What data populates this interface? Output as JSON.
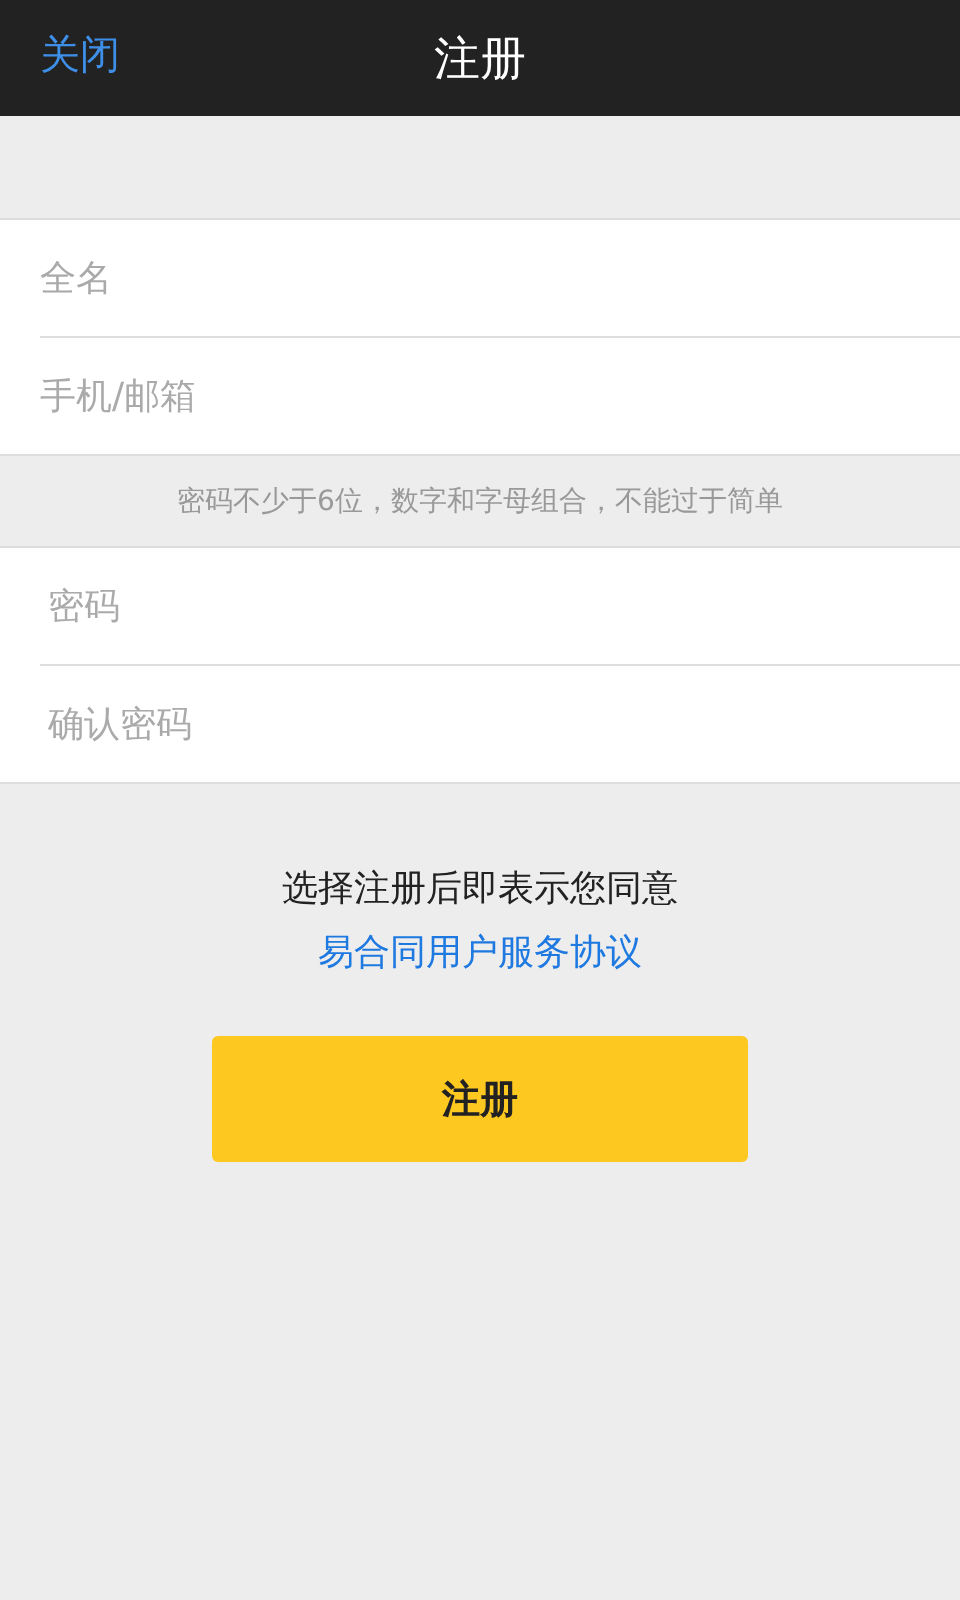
{
  "header": {
    "close": "关闭",
    "title": "注册"
  },
  "identity_fields": [
    {
      "placeholder": "全名"
    },
    {
      "placeholder": "手机/邮箱"
    }
  ],
  "password_hint": "密码不少于6位，数字和字母组合，不能过于简单",
  "password_fields": [
    {
      "placeholder": "密码"
    },
    {
      "placeholder": "确认密码"
    }
  ],
  "agreement": {
    "text": "选择注册后即表示您同意",
    "link": "易合同用户服务协议"
  },
  "register_button": "注册"
}
